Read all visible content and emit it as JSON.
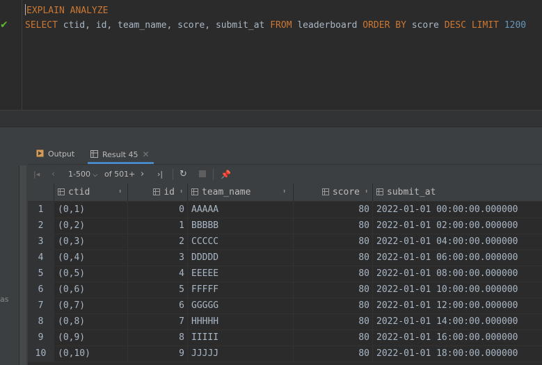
{
  "editor": {
    "line1": {
      "kw": "EXPLAIN ANALYZE"
    },
    "line2": {
      "select": "SELECT",
      "cols": " ctid, id, team_name, score, submit_at ",
      "from": "FROM",
      "table": " leaderboard ",
      "order": "ORDER BY",
      "col": " score ",
      "desc": "DESC",
      "limit": " LIMIT ",
      "n": "1200"
    }
  },
  "tabs": {
    "output": "Output",
    "result": "Result 45"
  },
  "toolbar": {
    "range": "1-500",
    "total": "of 501+"
  },
  "grid": {
    "columns": [
      "ctid",
      "id",
      "team_name",
      "score",
      "submit_at"
    ],
    "rows": [
      [
        "1",
        "(0,1)",
        "0",
        "AAAAA",
        "80",
        "2022-01-01 00:00:00.000000"
      ],
      [
        "2",
        "(0,2)",
        "1",
        "BBBBB",
        "80",
        "2022-01-01 02:00:00.000000"
      ],
      [
        "3",
        "(0,3)",
        "2",
        "CCCCC",
        "80",
        "2022-01-01 04:00:00.000000"
      ],
      [
        "4",
        "(0,4)",
        "3",
        "DDDDD",
        "80",
        "2022-01-01 06:00:00.000000"
      ],
      [
        "5",
        "(0,5)",
        "4",
        "EEEEE",
        "80",
        "2022-01-01 08:00:00.000000"
      ],
      [
        "6",
        "(0,6)",
        "5",
        "FFFFF",
        "80",
        "2022-01-01 10:00:00.000000"
      ],
      [
        "7",
        "(0,7)",
        "6",
        "GGGGG",
        "80",
        "2022-01-01 12:00:00.000000"
      ],
      [
        "8",
        "(0,8)",
        "7",
        "HHHHH",
        "80",
        "2022-01-01 14:00:00.000000"
      ],
      [
        "9",
        "(0,9)",
        "8",
        "IIIII",
        "80",
        "2022-01-01 16:00:00.000000"
      ],
      [
        "10",
        "(0,10)",
        "9",
        "JJJJJ",
        "80",
        "2022-01-01 18:00:00.000000"
      ]
    ]
  },
  "sidebar": {
    "fragment": "as"
  },
  "icons": {
    "check": "checkmark-icon",
    "output": "output-icon",
    "table": "table-icon",
    "first": "first-page-icon",
    "prev": "prev-page-icon",
    "next": "next-page-icon",
    "last": "last-page-icon",
    "refresh": "refresh-icon",
    "stop": "stop-icon",
    "pin": "pin-icon"
  },
  "colors": {
    "keyword": "#cc7832",
    "table": "#ffc66d",
    "number": "#6897bb",
    "accent": "#4a88c7",
    "success": "#5fb832"
  }
}
